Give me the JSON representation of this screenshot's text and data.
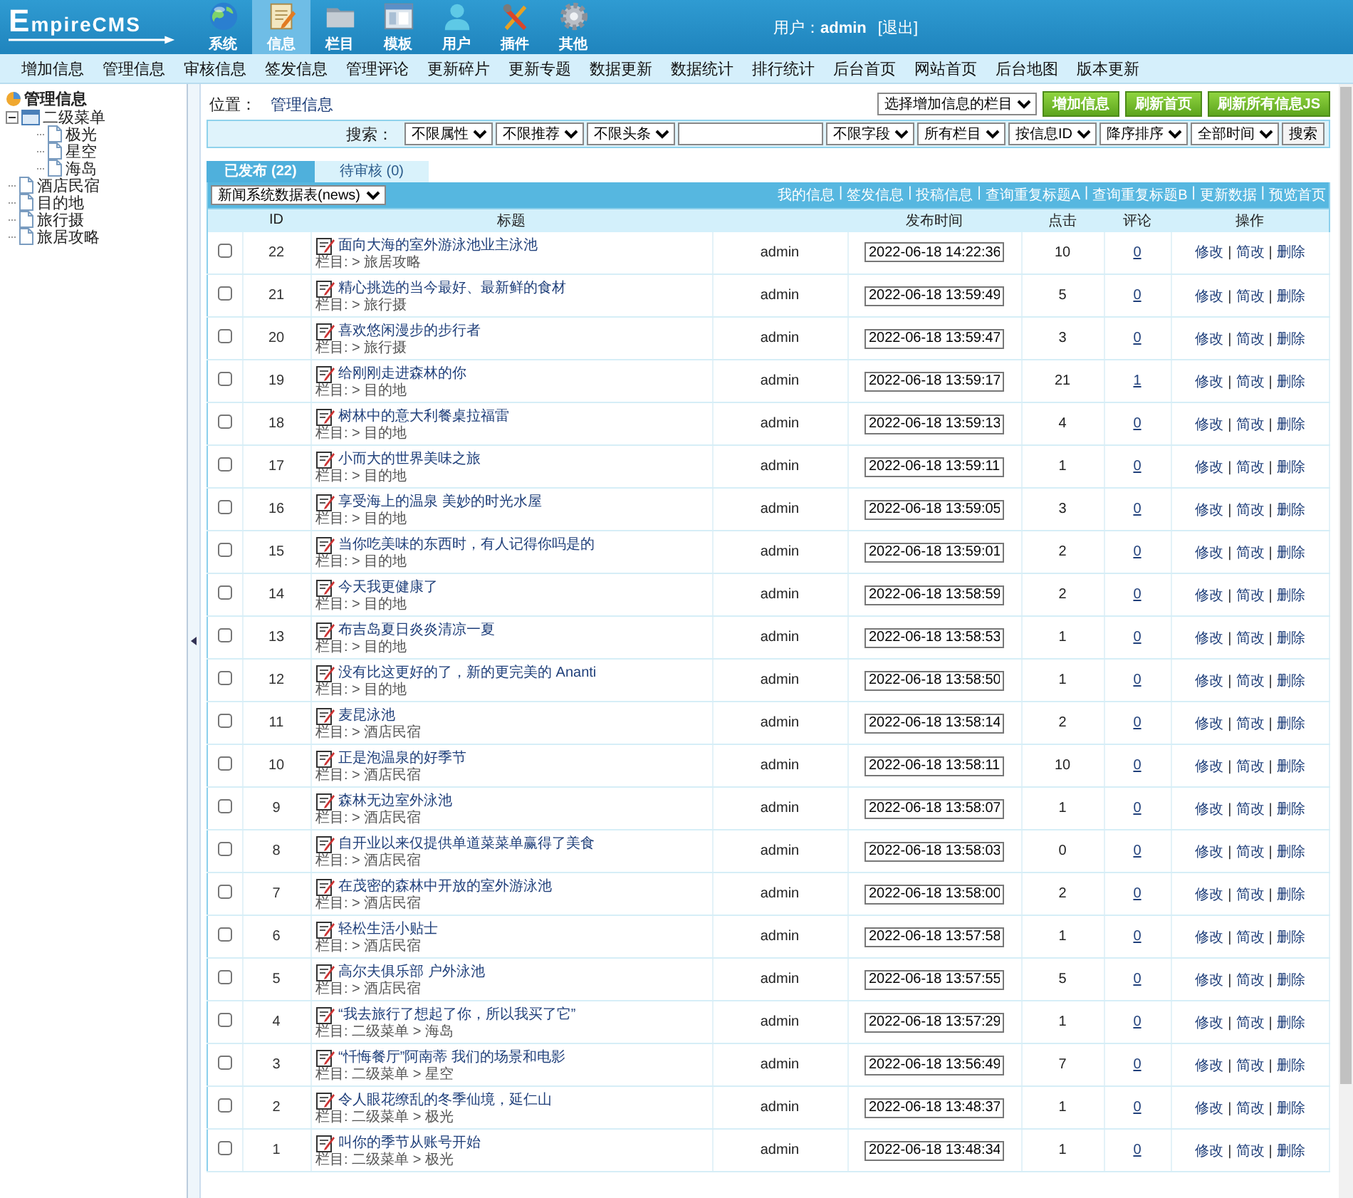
{
  "header": {
    "logo": "EmpireCMS",
    "nav": [
      {
        "label": "系统",
        "selected": false
      },
      {
        "label": "信息",
        "selected": true
      },
      {
        "label": "栏目",
        "selected": false
      },
      {
        "label": "模板",
        "selected": false
      },
      {
        "label": "用户",
        "selected": false
      },
      {
        "label": "插件",
        "selected": false
      },
      {
        "label": "其他",
        "selected": false
      }
    ],
    "user_label": "用户：",
    "user_name": "admin",
    "logout": "[退出]"
  },
  "menu": [
    "增加信息",
    "管理信息",
    "审核信息",
    "签发信息",
    "管理评论",
    "更新碎片",
    "更新专题",
    "数据更新",
    "数据统计",
    "排行统计",
    "后台首页",
    "网站首页",
    "后台地图",
    "版本更新"
  ],
  "sidebar": {
    "title": "管理信息",
    "items": [
      {
        "label": "二级菜单",
        "expanded": true,
        "children": [
          {
            "label": "极光"
          },
          {
            "label": "星空"
          },
          {
            "label": "海岛"
          }
        ]
      },
      {
        "label": "酒店民宿"
      },
      {
        "label": "目的地"
      },
      {
        "label": "旅行摄"
      },
      {
        "label": "旅居攻略"
      }
    ]
  },
  "location": {
    "label": "位置：",
    "link": "管理信息"
  },
  "toolbar": {
    "column_select": "选择增加信息的栏目",
    "buttons": [
      "增加信息",
      "刷新首页",
      "刷新所有信息JS"
    ]
  },
  "search": {
    "label": "搜索：",
    "filters_before": [
      "不限属性",
      "不限推荐",
      "不限头条"
    ],
    "filters_after": [
      "不限字段",
      "所有栏目",
      "按信息ID",
      "降序排序",
      "全部时间"
    ],
    "button": "搜索"
  },
  "tabs": [
    {
      "label": "已发布 (22)",
      "selected": true
    },
    {
      "label": "待审核 (0)",
      "selected": false
    }
  ],
  "table_select": "新闻系统数据表(news)",
  "table_links": [
    "我的信息",
    "|",
    "签发信息",
    "|",
    "投稿信息",
    "|",
    "查询重复标题A",
    "|",
    "查询重复标题B",
    "|",
    "更新数据",
    "|",
    "预览首页"
  ],
  "table": {
    "columns": {
      "id": "ID",
      "title": "标题",
      "time": "发布时间",
      "clicks": "点击",
      "comments": "评论",
      "actions": "操作"
    },
    "rows": [
      {
        "checked": false,
        "id": "22",
        "title": "面向大海的室外游泳池业主泳池",
        "category": "栏目: > 旅居攻略",
        "author": "admin",
        "time": "2022-06-18 14:22:36",
        "clicks": "10",
        "comments": "0",
        "actions": [
          "修改",
          "|",
          "简改",
          "|",
          "删除"
        ]
      },
      {
        "checked": false,
        "id": "21",
        "title": "精心挑选的当今最好、最新鲜的食材",
        "category": "栏目: > 旅行摄",
        "author": "admin",
        "time": "2022-06-18 13:59:49",
        "clicks": "5",
        "comments": "0",
        "actions": [
          "修改",
          "|",
          "简改",
          "|",
          "删除"
        ]
      },
      {
        "checked": false,
        "id": "20",
        "title": "喜欢悠闲漫步的步行者",
        "category": "栏目: > 旅行摄",
        "author": "admin",
        "time": "2022-06-18 13:59:47",
        "clicks": "3",
        "comments": "0",
        "actions": [
          "修改",
          "|",
          "简改",
          "|",
          "删除"
        ]
      },
      {
        "checked": false,
        "id": "19",
        "title": "给刚刚走进森林的你",
        "category": "栏目: > 目的地",
        "author": "admin",
        "time": "2022-06-18 13:59:17",
        "clicks": "21",
        "comments": "1",
        "actions": [
          "修改",
          "|",
          "简改",
          "|",
          "删除"
        ]
      },
      {
        "checked": false,
        "id": "18",
        "title": "树林中的意大利餐桌拉福雷",
        "category": "栏目: > 目的地",
        "author": "admin",
        "time": "2022-06-18 13:59:13",
        "clicks": "4",
        "comments": "0",
        "actions": [
          "修改",
          "|",
          "简改",
          "|",
          "删除"
        ]
      },
      {
        "checked": false,
        "id": "17",
        "title": "小而大的世界美味之旅",
        "category": "栏目: > 目的地",
        "author": "admin",
        "time": "2022-06-18 13:59:11",
        "clicks": "1",
        "comments": "0",
        "actions": [
          "修改",
          "|",
          "简改",
          "|",
          "删除"
        ]
      },
      {
        "checked": false,
        "id": "16",
        "title": "享受海上的温泉 美妙的时光水屋",
        "category": "栏目: > 目的地",
        "author": "admin",
        "time": "2022-06-18 13:59:05",
        "clicks": "3",
        "comments": "0",
        "actions": [
          "修改",
          "|",
          "简改",
          "|",
          "删除"
        ]
      },
      {
        "checked": false,
        "id": "15",
        "title": "当你吃美味的东西时，有人记得你吗是的",
        "category": "栏目: > 目的地",
        "author": "admin",
        "time": "2022-06-18 13:59:01",
        "clicks": "2",
        "comments": "0",
        "actions": [
          "修改",
          "|",
          "简改",
          "|",
          "删除"
        ]
      },
      {
        "checked": false,
        "id": "14",
        "title": "今天我更健康了",
        "category": "栏目: > 目的地",
        "author": "admin",
        "time": "2022-06-18 13:58:59",
        "clicks": "2",
        "comments": "0",
        "actions": [
          "修改",
          "|",
          "简改",
          "|",
          "删除"
        ]
      },
      {
        "checked": false,
        "id": "13",
        "title": "布吉岛夏日炎炎清凉一夏",
        "category": "栏目: > 目的地",
        "author": "admin",
        "time": "2022-06-18 13:58:53",
        "clicks": "1",
        "comments": "0",
        "actions": [
          "修改",
          "|",
          "简改",
          "|",
          "删除"
        ]
      },
      {
        "checked": false,
        "id": "12",
        "title": "没有比这更好的了，新的更完美的 Ananti",
        "category": "栏目: > 目的地",
        "author": "admin",
        "time": "2022-06-18 13:58:50",
        "clicks": "1",
        "comments": "0",
        "actions": [
          "修改",
          "|",
          "简改",
          "|",
          "删除"
        ]
      },
      {
        "checked": false,
        "id": "11",
        "title": "麦昆泳池",
        "category": "栏目: > 酒店民宿",
        "author": "admin",
        "time": "2022-06-18 13:58:14",
        "clicks": "2",
        "comments": "0",
        "actions": [
          "修改",
          "|",
          "简改",
          "|",
          "删除"
        ]
      },
      {
        "checked": false,
        "id": "10",
        "title": "正是泡温泉的好季节",
        "category": "栏目: > 酒店民宿",
        "author": "admin",
        "time": "2022-06-18 13:58:11",
        "clicks": "10",
        "comments": "0",
        "actions": [
          "修改",
          "|",
          "简改",
          "|",
          "删除"
        ]
      },
      {
        "checked": false,
        "id": "9",
        "title": "森林无边室外泳池",
        "category": "栏目: > 酒店民宿",
        "author": "admin",
        "time": "2022-06-18 13:58:07",
        "clicks": "1",
        "comments": "0",
        "actions": [
          "修改",
          "|",
          "简改",
          "|",
          "删除"
        ]
      },
      {
        "checked": false,
        "id": "8",
        "title": "自开业以来仅提供单道菜菜单赢得了美食",
        "category": "栏目: > 酒店民宿",
        "author": "admin",
        "time": "2022-06-18 13:58:03",
        "clicks": "0",
        "comments": "0",
        "actions": [
          "修改",
          "|",
          "简改",
          "|",
          "删除"
        ]
      },
      {
        "checked": false,
        "id": "7",
        "title": "在茂密的森林中开放的室外游泳池",
        "category": "栏目: > 酒店民宿",
        "author": "admin",
        "time": "2022-06-18 13:58:00",
        "clicks": "2",
        "comments": "0",
        "actions": [
          "修改",
          "|",
          "简改",
          "|",
          "删除"
        ]
      },
      {
        "checked": false,
        "id": "6",
        "title": "轻松生活小贴士",
        "category": "栏目: > 酒店民宿",
        "author": "admin",
        "time": "2022-06-18 13:57:58",
        "clicks": "1",
        "comments": "0",
        "actions": [
          "修改",
          "|",
          "简改",
          "|",
          "删除"
        ]
      },
      {
        "checked": false,
        "id": "5",
        "title": "高尔夫俱乐部 户外泳池",
        "category": "栏目: > 酒店民宿",
        "author": "admin",
        "time": "2022-06-18 13:57:55",
        "clicks": "5",
        "comments": "0",
        "actions": [
          "修改",
          "|",
          "简改",
          "|",
          "删除"
        ]
      },
      {
        "checked": false,
        "id": "4",
        "title": "“我去旅行了想起了你，所以我买了它”",
        "category": "栏目: 二级菜单 > 海岛",
        "author": "admin",
        "time": "2022-06-18 13:57:29",
        "clicks": "1",
        "comments": "0",
        "actions": [
          "修改",
          "|",
          "简改",
          "|",
          "删除"
        ]
      },
      {
        "checked": false,
        "id": "3",
        "title": "“忏悔餐厅”阿南蒂 我们的场景和电影",
        "category": "栏目: 二级菜单 > 星空",
        "author": "admin",
        "time": "2022-06-18 13:56:49",
        "clicks": "7",
        "comments": "0",
        "actions": [
          "修改",
          "|",
          "简改",
          "|",
          "删除"
        ]
      },
      {
        "checked": false,
        "id": "2",
        "title": "令人眼花缭乱的冬季仙境，延仁山",
        "category": "栏目: 二级菜单 > 极光",
        "author": "admin",
        "time": "2022-06-18 13:48:37",
        "clicks": "1",
        "comments": "0",
        "actions": [
          "修改",
          "|",
          "简改",
          "|",
          "删除"
        ]
      },
      {
        "checked": false,
        "id": "1",
        "title": "叫你的季节从账号开始",
        "category": "栏目: 二级菜单 > 极光",
        "author": "admin",
        "time": "2022-06-18 13:48:34",
        "clicks": "1",
        "comments": "0",
        "actions": [
          "修改",
          "|",
          "简改",
          "|",
          "删除"
        ]
      }
    ]
  }
}
